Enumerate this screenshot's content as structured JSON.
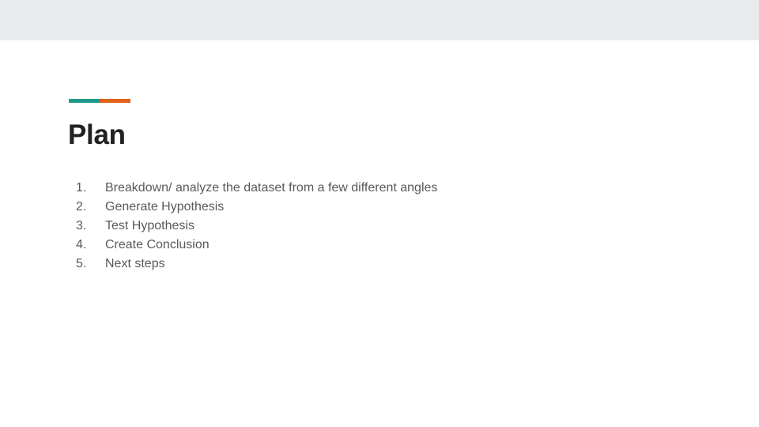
{
  "slide": {
    "title": "Plan",
    "accent_colors": [
      "#1e9a8a",
      "#e0621b"
    ],
    "band_color": "#e8ebeb",
    "items": [
      {
        "number": "1.",
        "text": "Breakdown/ analyze the dataset from a few different angles"
      },
      {
        "number": "2.",
        "text": "Generate Hypothesis"
      },
      {
        "number": "3.",
        "text": "Test Hypothesis"
      },
      {
        "number": "4.",
        "text": "Create Conclusion"
      },
      {
        "number": "5.",
        "text": "Next steps"
      }
    ]
  }
}
